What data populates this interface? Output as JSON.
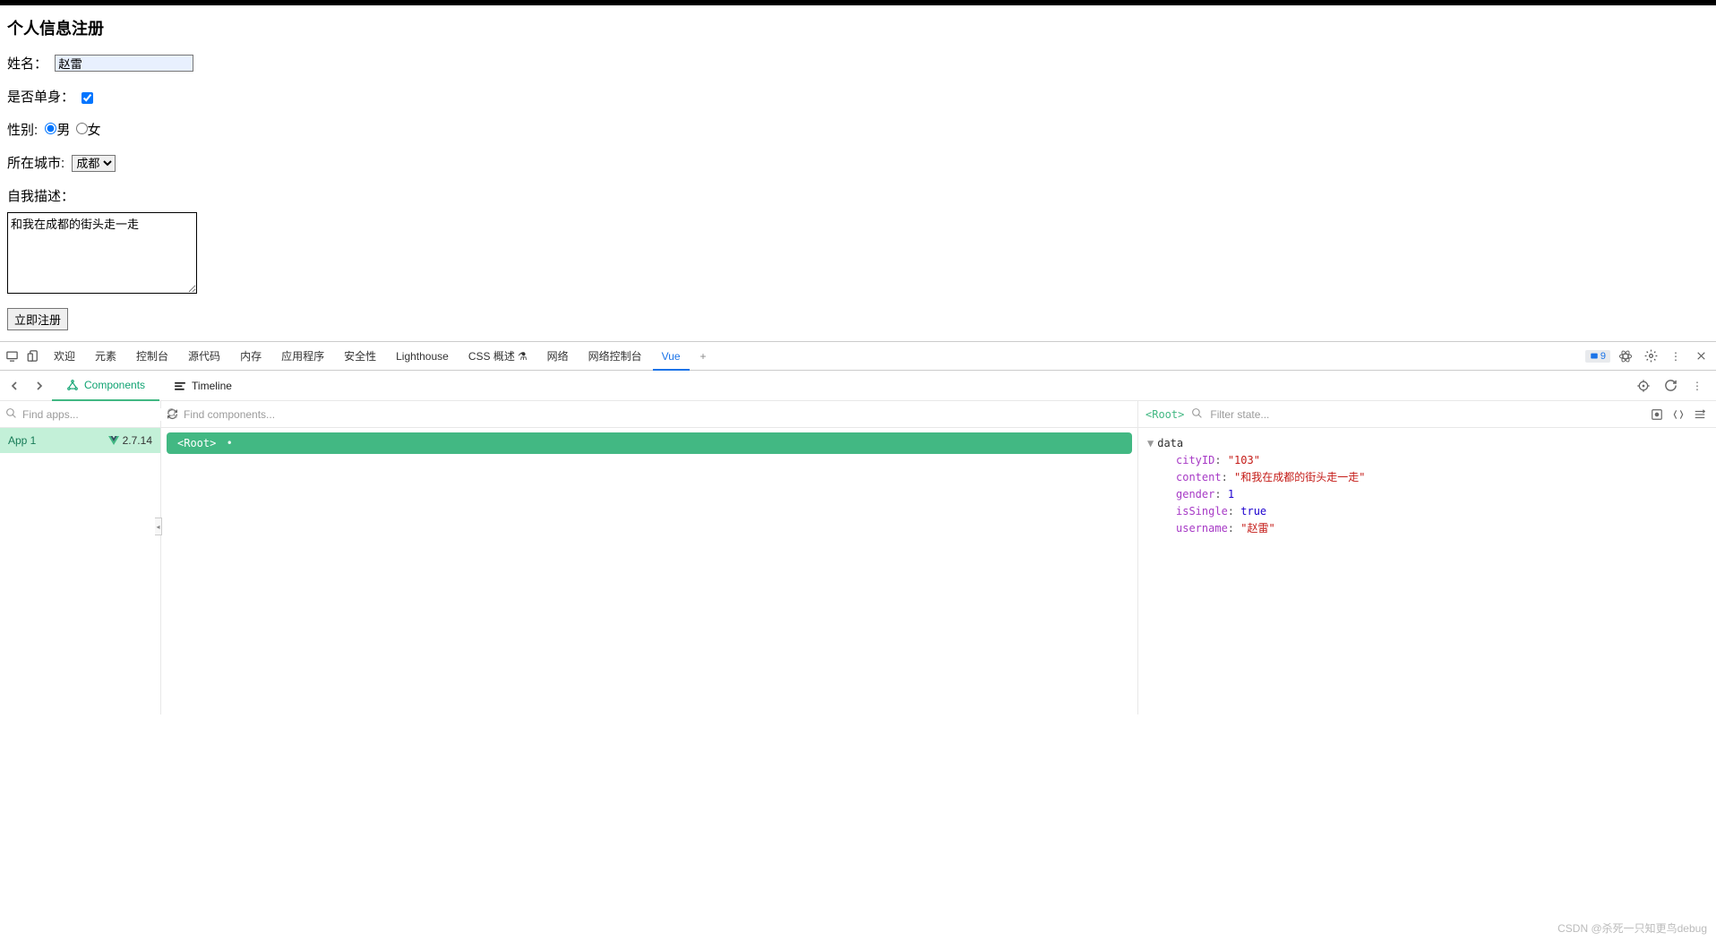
{
  "form": {
    "title": "个人信息注册",
    "name_label": "姓名：",
    "name_value": "赵雷",
    "single_label": "是否单身：",
    "single_checked": true,
    "gender_label": "性别:",
    "gender_male": "男",
    "gender_female": "女",
    "gender_value": "male",
    "city_label": "所在城市:",
    "city_selected": "成都",
    "desc_label": "自我描述：",
    "desc_value": "和我在成都的街头走一走",
    "submit_label": "立即注册"
  },
  "devtools": {
    "tabs": [
      "欢迎",
      "元素",
      "控制台",
      "源代码",
      "内存",
      "应用程序",
      "安全性",
      "Lighthouse",
      "CSS 概述",
      "网络",
      "网络控制台",
      "Vue"
    ],
    "active_tab": "Vue",
    "issues_count": "9"
  },
  "vue_panel": {
    "nav": {
      "components": "Components",
      "timeline": "Timeline"
    },
    "apps": {
      "search_placeholder": "Find apps...",
      "app_name": "App 1",
      "vue_version": "2.7.14"
    },
    "comps": {
      "search_placeholder": "Find components...",
      "root_label": "<Root>",
      "root_marker": "•"
    },
    "state": {
      "root_label": "<Root>",
      "filter_placeholder": "Filter state...",
      "data_label": "data",
      "props": {
        "cityID": {
          "key": "cityID",
          "value": "\"103\"",
          "type": "str"
        },
        "content": {
          "key": "content",
          "value": "\"和我在成都的街头走一走\"",
          "type": "str"
        },
        "gender": {
          "key": "gender",
          "value": "1",
          "type": "num"
        },
        "isSingle": {
          "key": "isSingle",
          "value": "true",
          "type": "num"
        },
        "username": {
          "key": "username",
          "value": "\"赵雷\"",
          "type": "str"
        }
      }
    }
  },
  "watermark": "CSDN @杀死一只知更鸟debug"
}
